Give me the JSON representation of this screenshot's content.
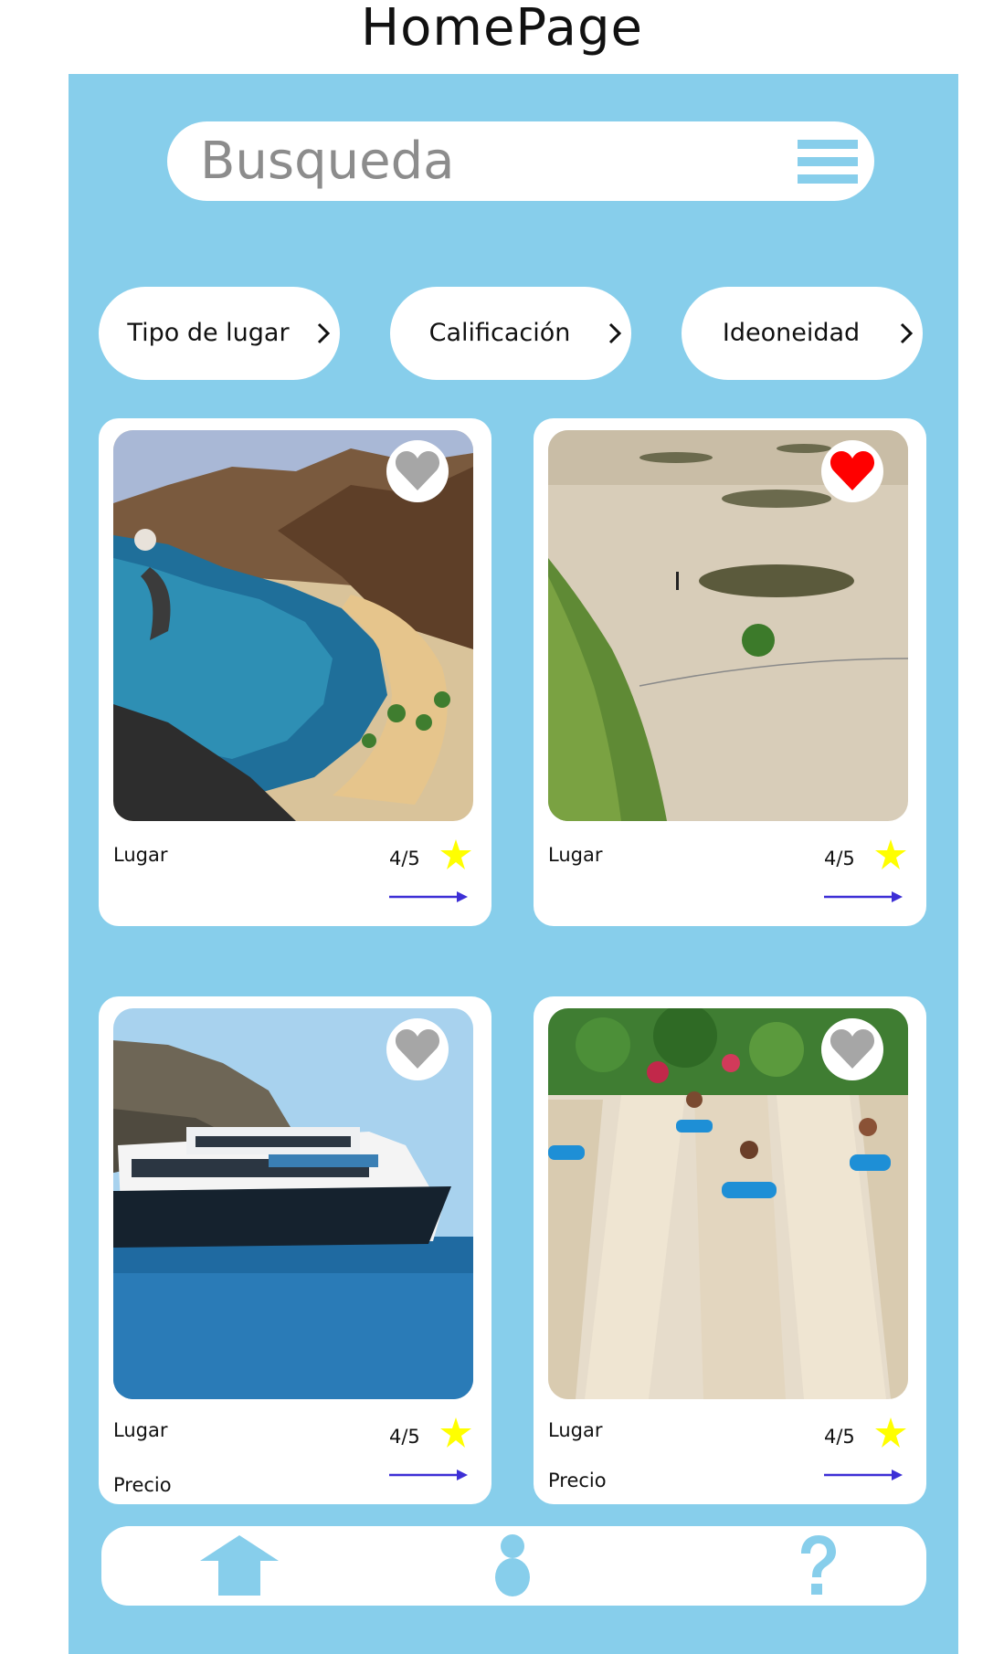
{
  "page": {
    "title": "HomePage"
  },
  "search": {
    "placeholder": "Busqueda"
  },
  "colors": {
    "background": "#87ceeb",
    "surface": "#ffffff",
    "accent": "#87ceeb",
    "favorite_active": "#ff0000",
    "favorite_inactive": "#a6a6a6",
    "star": "#ffff00",
    "arrow": "#3d2fd6"
  },
  "filters": [
    {
      "label": "Tipo de lugar",
      "icon": "chevron-right-icon"
    },
    {
      "label": "Calificación",
      "icon": "chevron-right-icon"
    },
    {
      "label": "Ideoneidad",
      "icon": "chevron-right-icon"
    }
  ],
  "cards": [
    {
      "image": "beach-photo",
      "place": "Lugar",
      "rating": "4/5",
      "favorite": false
    },
    {
      "image": "dunes-photo",
      "place": "Lugar",
      "rating": "4/5",
      "favorite": true
    },
    {
      "image": "ferry-photo",
      "place": "Lugar",
      "price": "Precio",
      "rating": "4/5",
      "favorite": false
    },
    {
      "image": "waterslide-photo",
      "place": "Lugar",
      "price": "Precio",
      "rating": "4/5",
      "favorite": false
    }
  ],
  "navbar": [
    {
      "icon": "home-icon"
    },
    {
      "icon": "user-icon"
    },
    {
      "icon": "help-icon"
    }
  ]
}
